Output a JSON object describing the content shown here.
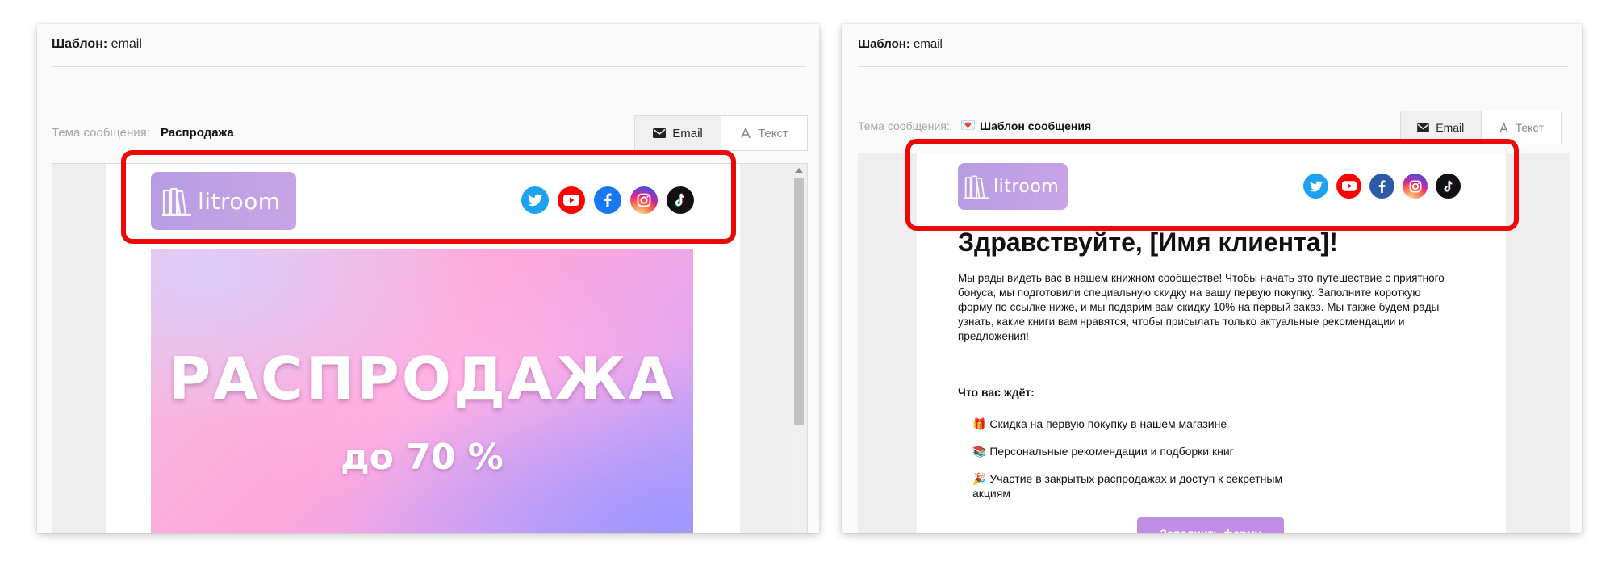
{
  "left_panel": {
    "template_prefix": "Шаблон:",
    "template_name": "email",
    "subject_label": "Тема сообщения:",
    "subject_value": "Распродажа",
    "tabs": [
      {
        "label": "Email",
        "icon": "envelope-icon",
        "active": true
      },
      {
        "label": "Текст",
        "icon": "text-a-icon",
        "active": false
      }
    ],
    "logo_text": "litroom",
    "banner": {
      "title": "РАСПРОДАЖА",
      "subtitle": "до 70 %"
    }
  },
  "right_panel": {
    "template_prefix": "Шаблон:",
    "template_name": "email",
    "subject_label": "Тема сообщения:",
    "subject_emoji": "💌",
    "subject_value": "Шаблон сообщения",
    "tabs": [
      {
        "label": "Email",
        "icon": "envelope-icon",
        "active": true
      },
      {
        "label": "Текст",
        "icon": "text-a-icon",
        "active": false
      }
    ],
    "logo_text": "litroom",
    "greeting": "Здравствуйте, [Имя клиента]!",
    "intro": "Мы рады видеть вас в нашем книжном сообществе! Чтобы начать это путешествие с приятного бонуса, мы подготовили специальную скидку на вашу первую покупку. Заполните короткую форму по ссылке ниже, и мы подарим вам скидку 10% на первый заказ. Мы также будем рады узнать, какие книги вам нравятся, чтобы присылать только актуальные рекомендации и предложения!",
    "wait_heading": "Что вас ждёт:",
    "benefits": [
      {
        "emoji": "🎁",
        "text": "Скидка на первую покупку в нашем магазине"
      },
      {
        "emoji": "📚",
        "text": "Персональные рекомендации и подборки книг"
      },
      {
        "emoji": "🎉",
        "text": "Участие в закрытых распродажах и доступ к секретным акциям"
      }
    ],
    "cta_label": "Заполнить форму"
  },
  "social_icons": [
    {
      "name": "twitter-icon",
      "color": "#1da1f2"
    },
    {
      "name": "youtube-icon",
      "color": "#ff0000"
    },
    {
      "name": "facebook-icon",
      "color": "#1877f2"
    },
    {
      "name": "instagram-icon",
      "color": "#e1306c"
    },
    {
      "name": "tiktok-icon",
      "color": "#111111"
    }
  ],
  "colors": {
    "highlight": "#ea0a0a",
    "logo_bg": "#b79ce3",
    "cta_bg": "#c18ee6"
  }
}
